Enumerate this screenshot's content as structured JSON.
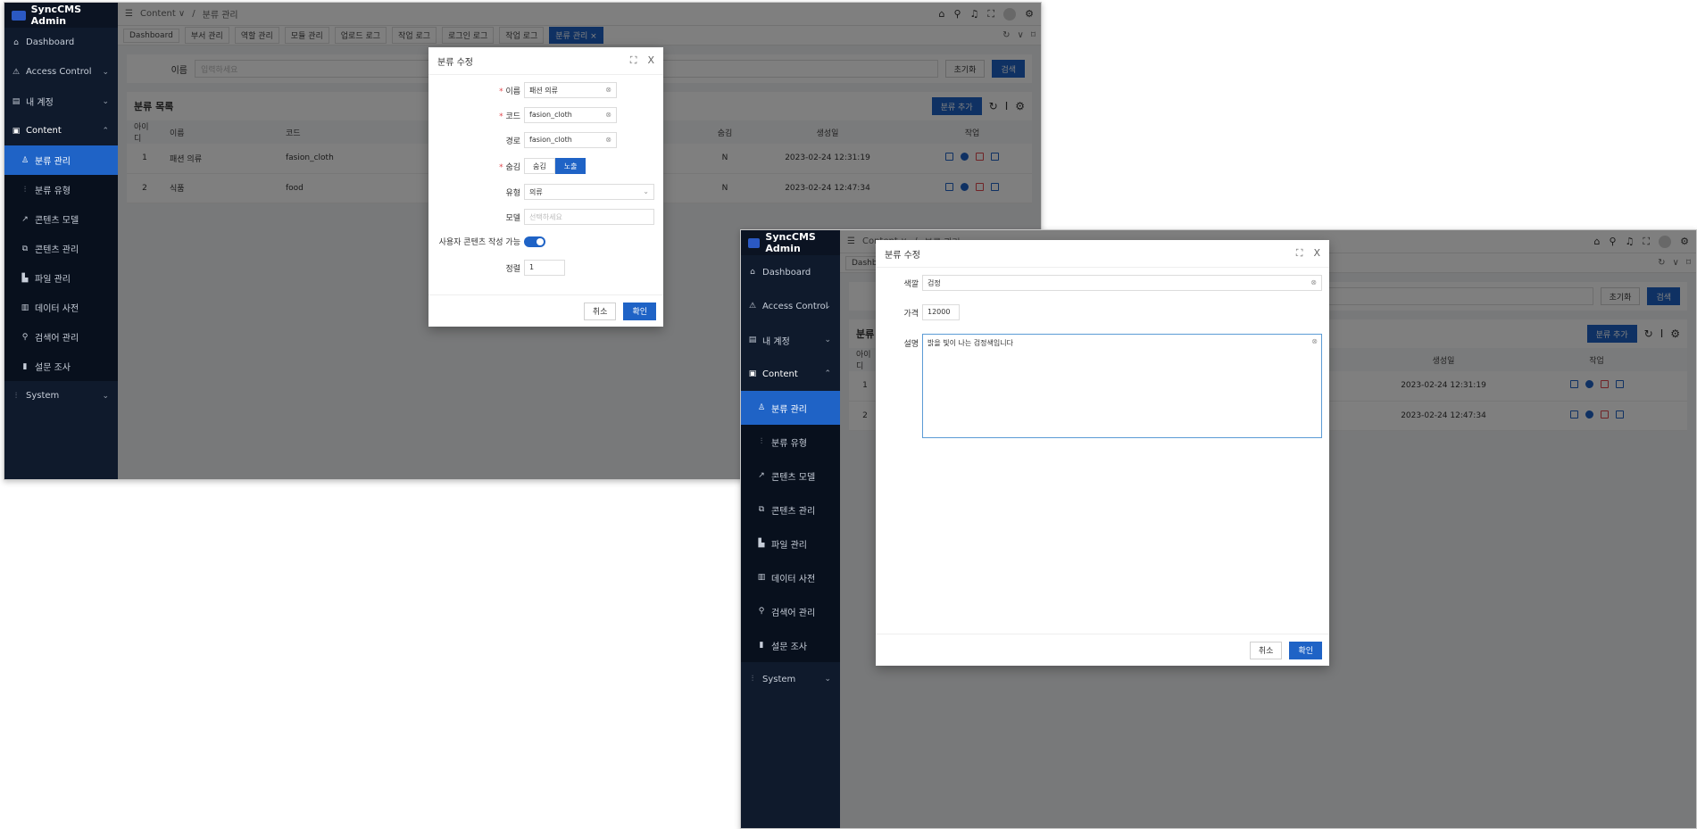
{
  "app": {
    "brand": "SyncCMS Admin",
    "breadcrumb_root": "Content ∨",
    "breadcrumb_sep": "/",
    "breadcrumb_page": "분류 관리"
  },
  "sidebar": {
    "dashboard": "Dashboard",
    "access_control": "Access Control",
    "my_account": "내 계정",
    "content": "Content",
    "sub": [
      "분류 관리",
      "분류 유형",
      "콘텐츠 모델",
      "콘텐츠 관리",
      "파일 관리",
      "데이터 사전",
      "검색어 관리",
      "설문 조사"
    ],
    "system": "System"
  },
  "tabs": [
    "Dashboard",
    "부서 관리",
    "역할 관리",
    "모듈 관리",
    "업로드 로그",
    "작업 로그",
    "로그인 로그",
    "작업 로그",
    "분류 관리 ×"
  ],
  "search": {
    "label": "이름",
    "placeholder": "입력하세요",
    "placeholder_short": "입력하",
    "reset": "초기화",
    "submit": "검색"
  },
  "list": {
    "title": "분류 목록",
    "add_button": "분류 추가",
    "columns": {
      "id": "아이디",
      "name": "이름",
      "code": "코드",
      "hidden": "숨김",
      "created": "생성일",
      "actions": "작업"
    },
    "rows": [
      {
        "id": "1",
        "name": "패션 의류",
        "code": "fasion_cloth",
        "hidden": "N",
        "created": "2023-02-24 12:31:19"
      },
      {
        "id": "2",
        "name": "식품",
        "code": "food",
        "hidden": "N",
        "created": "2023-02-24 12:47:34"
      }
    ]
  },
  "modalA": {
    "title": "분류 수정",
    "fields": {
      "name_label": "이름",
      "name_value": "패션 의류",
      "code_label": "코드",
      "code_value": "fasion_cloth",
      "path_label": "경로",
      "path_value": "fasion_cloth",
      "hidden_label": "숨김",
      "hidden_opt1": "숨김",
      "hidden_opt2": "노출",
      "type_label": "유형",
      "type_value": "의류",
      "model_label": "모델",
      "model_placeholder": "선택하세요",
      "ugc_label": "사용자 콘텐츠 작성 가능",
      "order_label": "정렬",
      "order_value": "1"
    },
    "cancel": "취소",
    "ok": "확인"
  },
  "modalB": {
    "title": "분류 수정",
    "fields": {
      "color_label": "색깔",
      "color_value": "검정",
      "price_label": "가격",
      "price_value": "12000",
      "desc_label": "설명",
      "desc_value": "밝을 빛이 나는 검정색입니다"
    },
    "cancel": "취소",
    "ok": "확인"
  },
  "icons": {
    "menu": "☰",
    "home": "⌂",
    "search": "⚲",
    "bell": "♫",
    "full": "⛶",
    "gear": "⚙",
    "refresh": "↻",
    "down": "∨",
    "pin": "⌑",
    "expand": "⛶",
    "close": "X",
    "col": "Ⅰ",
    "clear": "⊗",
    "chevron_down": "⌄",
    "chevron_up": "⌃"
  },
  "colors": {
    "primary": "#1f63c6",
    "sidebar": "#0f1a2c",
    "danger": "#e0474d"
  }
}
